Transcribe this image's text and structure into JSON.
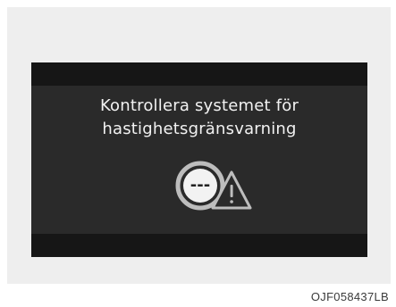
{
  "display": {
    "message_line1": "Kontrollera systemet för",
    "message_line2": "hastighetsgränsvarning",
    "speed_limit_placeholder": "---",
    "icons": [
      "speed-limit-sign-icon",
      "warning-triangle-icon"
    ]
  },
  "caption": "OJF058437LB",
  "colors": {
    "panel_bg": "#eeeeee",
    "display_bg": "#2a2a2a",
    "display_strip": "#161616",
    "text": "#f2f2f2",
    "icon_ring": "#bdbdbd"
  }
}
